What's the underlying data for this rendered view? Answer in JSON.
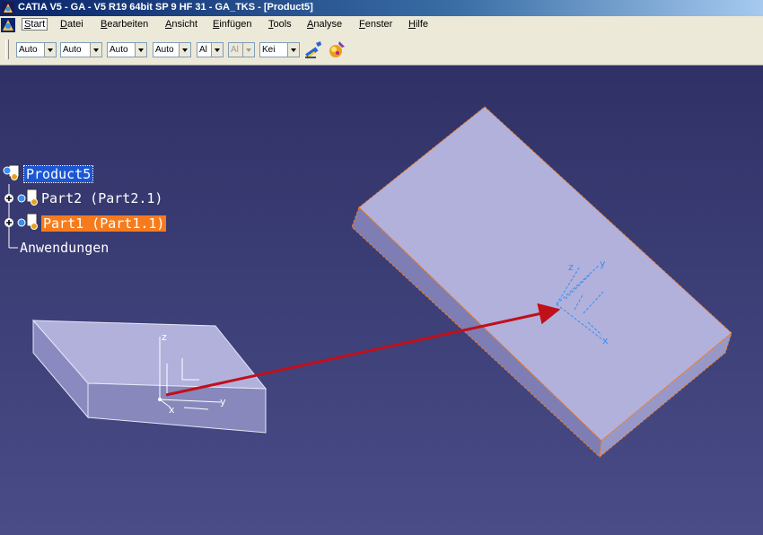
{
  "window": {
    "title": "CATIA V5 - GA - V5 R19 64bit SP 9 HF 31 - GA_TKS - [Product5]"
  },
  "menu": {
    "items": [
      "Start",
      "Datei",
      "Bearbeiten",
      "Ansicht",
      "Einfügen",
      "Tools",
      "Analyse",
      "Fenster",
      "Hilfe"
    ],
    "active": "Start"
  },
  "toolbar": {
    "combos": [
      {
        "value": "Auto",
        "enabled": true
      },
      {
        "value": "Auto",
        "enabled": true
      },
      {
        "value": "Auto",
        "enabled": true
      },
      {
        "value": "Auto",
        "enabled": true
      },
      {
        "value": "Al",
        "enabled": true
      },
      {
        "value": "Al",
        "enabled": false
      },
      {
        "value": "Kei",
        "enabled": true
      }
    ],
    "icons": [
      "format-painter-icon",
      "graphic-properties-icon"
    ]
  },
  "tree": {
    "root": "Product5",
    "children": [
      "Part2 (Part2.1)",
      "Part1 (Part1.1)"
    ],
    "applications": "Anwendungen"
  },
  "axes": {
    "x": "x",
    "y": "y",
    "z": "z"
  },
  "colors": {
    "background": "#34366a",
    "part_face": "#b1b1dc",
    "selection_orange": "#f77b1c",
    "tree_selection": "#1b57d4",
    "arrow": "#c0101a",
    "axis_selected": "#3a8ef0"
  }
}
